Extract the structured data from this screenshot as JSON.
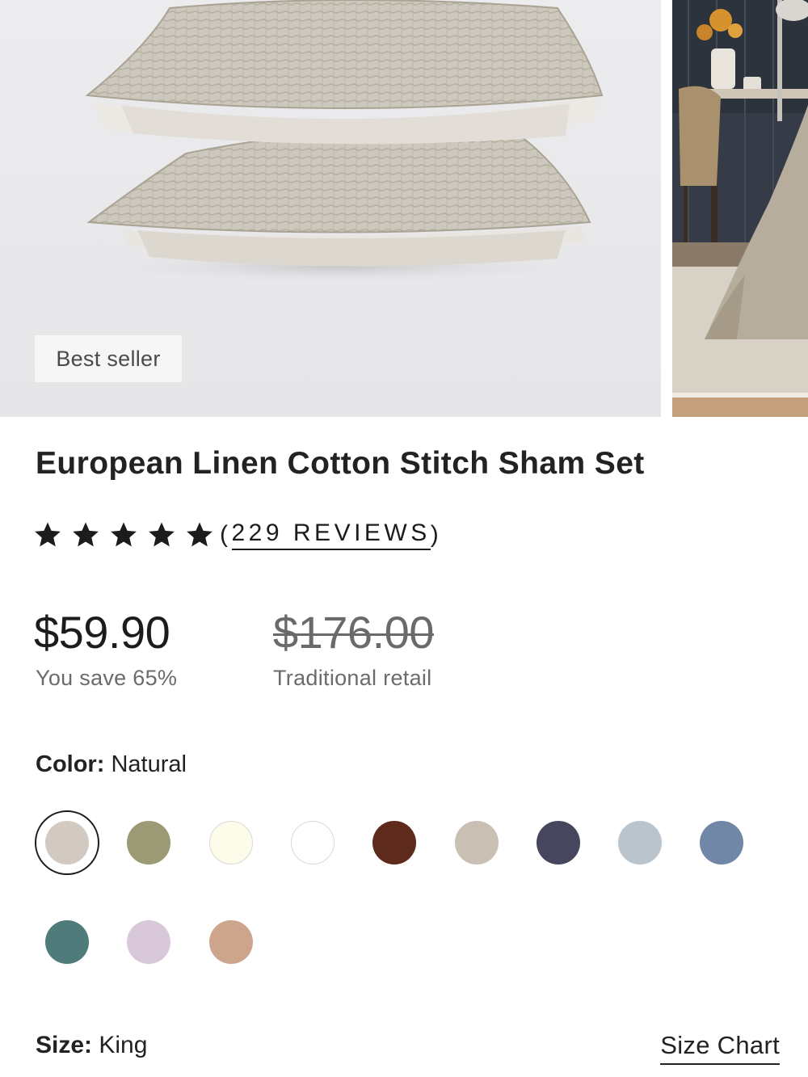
{
  "gallery": {
    "badge": "Best seller"
  },
  "product": {
    "title": "European Linen Cotton Stitch Sham Set"
  },
  "rating": {
    "stars": 5,
    "reviews_prefix": "(",
    "reviews_link": "229 REVIEWS",
    "reviews_suffix": ")"
  },
  "pricing": {
    "price": "$59.90",
    "savings": "You save 65%",
    "retail_price": "$176.00",
    "retail_label": "Traditional retail"
  },
  "color": {
    "label": "Color:",
    "value": "Natural",
    "swatches": [
      {
        "hex": "#d2cac0",
        "selected": true
      },
      {
        "hex": "#9b9a74"
      },
      {
        "hex": "#fdfbe9"
      },
      {
        "hex": "#ffffff"
      },
      {
        "hex": "#5e2a1b"
      },
      {
        "hex": "#c9bfb3"
      },
      {
        "hex": "#46465f"
      },
      {
        "hex": "#b9c4cd"
      },
      {
        "hex": "#7187a8"
      },
      {
        "hex": "#4f7c7a"
      },
      {
        "hex": "#d8c8da"
      },
      {
        "hex": "#cda58c"
      }
    ]
  },
  "size": {
    "label": "Size:",
    "value": "King",
    "chart_link": "Size Chart"
  }
}
